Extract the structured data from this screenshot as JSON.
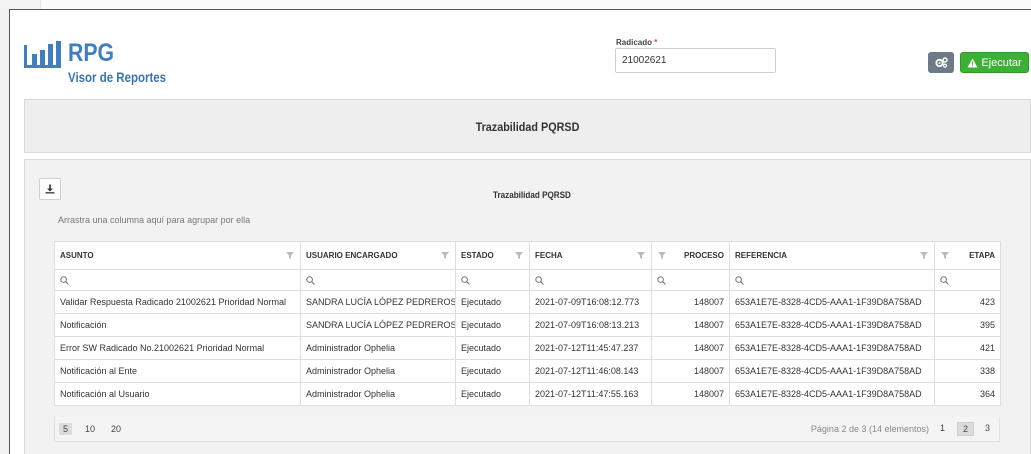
{
  "app": {
    "name": "RPG",
    "subtitle": "Visor de Reportes"
  },
  "filter": {
    "label": "Radicado",
    "required_mark": "*",
    "value": "21002621"
  },
  "toolbar": {
    "gear_icon": "gears-icon",
    "run_label": "Ejecutar"
  },
  "report": {
    "title": "Trazabilidad PQRSD",
    "grid_title": "Trazabilidad PQRSD",
    "group_hint": "Arrastra una columna aquí para agrupar por ella"
  },
  "columns": {
    "asunto": "ASUNTO",
    "usuario": "USUARIO ENCARGADO",
    "estado": "ESTADO",
    "fecha": "FECHA",
    "proceso": "PROCESO",
    "referencia": "REFERENCIA",
    "etapa": "ETAPA"
  },
  "rows": [
    {
      "asunto": "Validar Respuesta Radicado 21002621 Prioridad Normal",
      "usuario": "SANDRA LUCÍA LÓPEZ PEDREROS",
      "estado": "Ejecutado",
      "fecha": "2021-07-09T16:08:12.773",
      "proceso": "148007",
      "referencia": "653A1E7E-8328-4CD5-AAA1-1F39D8A758AD",
      "etapa": "423"
    },
    {
      "asunto": "Notificación",
      "usuario": "SANDRA LUCÍA LÓPEZ PEDREROS",
      "estado": "Ejecutado",
      "fecha": "2021-07-09T16:08:13.213",
      "proceso": "148007",
      "referencia": "653A1E7E-8328-4CD5-AAA1-1F39D8A758AD",
      "etapa": "395"
    },
    {
      "asunto": "Error SW Radicado No.21002621 Prioridad Normal",
      "usuario": "Administrador Ophelia",
      "estado": "Ejecutado",
      "fecha": "2021-07-12T11:45:47.237",
      "proceso": "148007",
      "referencia": "653A1E7E-8328-4CD5-AAA1-1F39D8A758AD",
      "etapa": "421"
    },
    {
      "asunto": "Notificación al Ente",
      "usuario": "Administrador Ophelia",
      "estado": "Ejecutado",
      "fecha": "2021-07-12T11:46:08.143",
      "proceso": "148007",
      "referencia": "653A1E7E-8328-4CD5-AAA1-1F39D8A758AD",
      "etapa": "338"
    },
    {
      "asunto": "Notificación al Usuario",
      "usuario": "Administrador Ophelia",
      "estado": "Ejecutado",
      "fecha": "2021-07-12T11:47:55.163",
      "proceso": "148007",
      "referencia": "653A1E7E-8328-4CD5-AAA1-1F39D8A758AD",
      "etapa": "364"
    }
  ],
  "pager": {
    "sizes": [
      "5",
      "10",
      "20"
    ],
    "selected_size": "5",
    "info": "Página 2 de 3 (14 elementos)",
    "pages": [
      "1",
      "2",
      "3"
    ],
    "current_page": "2"
  },
  "colors": {
    "brand": "#3f7fbf",
    "run": "#3cb034",
    "gear": "#6d7b88"
  }
}
